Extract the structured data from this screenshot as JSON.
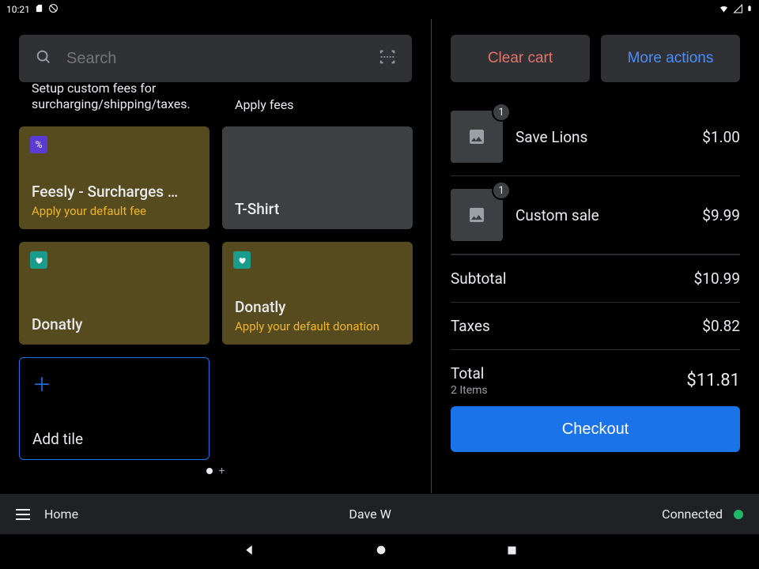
{
  "statusbar": {
    "time": "10:21"
  },
  "search": {
    "placeholder": "Search"
  },
  "tiles": {
    "row0a_sub": "Setup custom fees for surcharging/shipping/taxes.",
    "row0b_sub": "Apply fees",
    "feesly": {
      "title": "Feesly - Surcharges …",
      "sub": "Apply your default fee"
    },
    "tshirt": {
      "title": "T-Shirt"
    },
    "donatly1": {
      "title": "Donatly"
    },
    "donatly2": {
      "title": "Donatly",
      "sub": "Apply your default donation"
    },
    "add": {
      "label": "Add tile"
    }
  },
  "cart": {
    "clear": "Clear cart",
    "more": "More actions",
    "items": [
      {
        "qty": "1",
        "name": "Save Lions",
        "price": "$1.00"
      },
      {
        "qty": "1",
        "name": "Custom sale",
        "price": "$9.99"
      }
    ],
    "subtotal_label": "Subtotal",
    "subtotal": "$10.99",
    "taxes_label": "Taxes",
    "taxes": "$0.82",
    "total_label": "Total",
    "total_items": "2 Items",
    "total": "$11.81",
    "checkout": "Checkout"
  },
  "bottombar": {
    "home": "Home",
    "user": "Dave W",
    "status": "Connected"
  }
}
